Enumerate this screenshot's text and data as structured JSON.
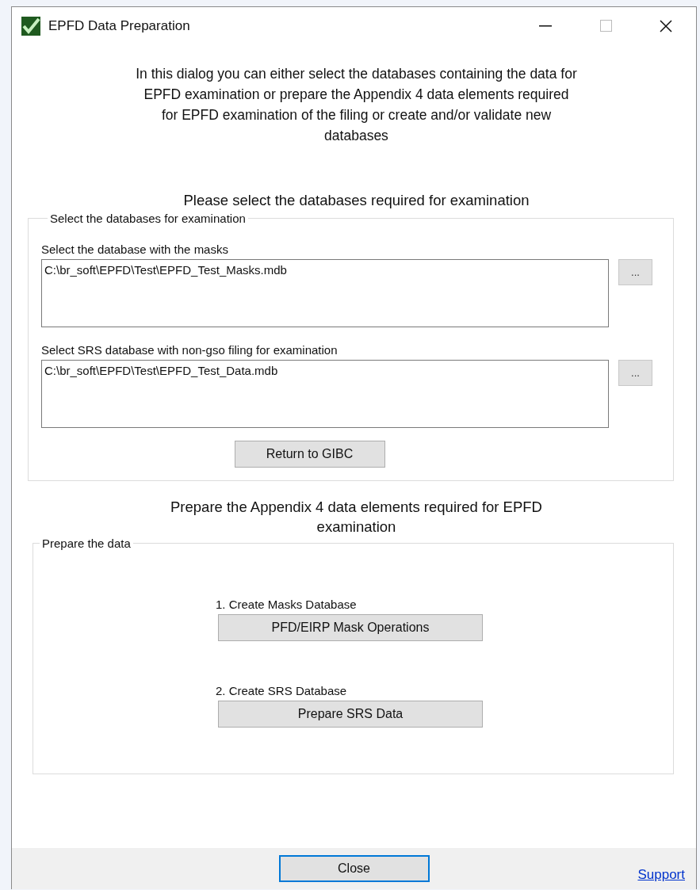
{
  "window": {
    "title": "EPFD Data Preparation"
  },
  "intro": "In this dialog you can either select the databases containing the data for EPFD examination or prepare the Appendix 4 data elements required for EPFD examination of the filing or create and/or validate new databases",
  "select_heading": "Please select the databases required for examination",
  "select_group": {
    "legend": "Select the databases for examination",
    "fields": [
      {
        "label": "Select the database with the masks",
        "value": "C:\\br_soft\\EPFD\\Test\\EPFD_Test_Masks.mdb",
        "browse": "..."
      },
      {
        "label": "Select SRS database with non-gso filing for examination",
        "value": "C:\\br_soft\\EPFD\\Test\\EPFD_Test_Data.mdb",
        "browse": "..."
      }
    ],
    "button": "Return to GIBC"
  },
  "prepare_heading": "Prepare the Appendix 4 data elements required for EPFD examination",
  "prepare_group": {
    "legend": "Prepare the data",
    "steps": [
      {
        "label": "1. Create Masks Database",
        "button": "PFD/EIRP Mask Operations"
      },
      {
        "label": "2. Create SRS Database",
        "button": "Prepare SRS Data"
      }
    ]
  },
  "footer": {
    "close": "Close",
    "link": "Support"
  }
}
